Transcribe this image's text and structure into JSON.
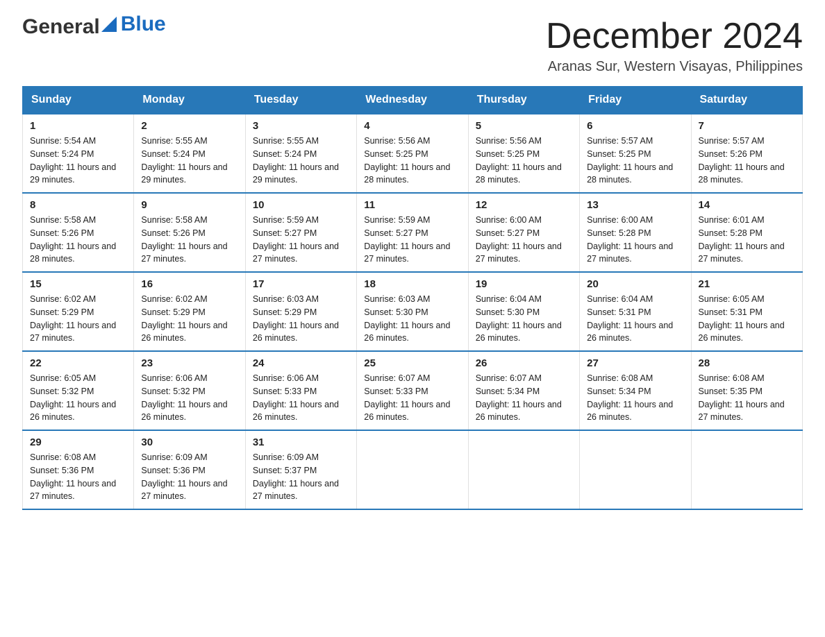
{
  "header": {
    "logo_general": "General",
    "logo_blue": "Blue",
    "month_title": "December 2024",
    "location": "Aranas Sur, Western Visayas, Philippines"
  },
  "weekdays": [
    "Sunday",
    "Monday",
    "Tuesday",
    "Wednesday",
    "Thursday",
    "Friday",
    "Saturday"
  ],
  "weeks": [
    [
      {
        "day": "1",
        "sunrise": "5:54 AM",
        "sunset": "5:24 PM",
        "daylight": "11 hours and 29 minutes."
      },
      {
        "day": "2",
        "sunrise": "5:55 AM",
        "sunset": "5:24 PM",
        "daylight": "11 hours and 29 minutes."
      },
      {
        "day": "3",
        "sunrise": "5:55 AM",
        "sunset": "5:24 PM",
        "daylight": "11 hours and 29 minutes."
      },
      {
        "day": "4",
        "sunrise": "5:56 AM",
        "sunset": "5:25 PM",
        "daylight": "11 hours and 28 minutes."
      },
      {
        "day": "5",
        "sunrise": "5:56 AM",
        "sunset": "5:25 PM",
        "daylight": "11 hours and 28 minutes."
      },
      {
        "day": "6",
        "sunrise": "5:57 AM",
        "sunset": "5:25 PM",
        "daylight": "11 hours and 28 minutes."
      },
      {
        "day": "7",
        "sunrise": "5:57 AM",
        "sunset": "5:26 PM",
        "daylight": "11 hours and 28 minutes."
      }
    ],
    [
      {
        "day": "8",
        "sunrise": "5:58 AM",
        "sunset": "5:26 PM",
        "daylight": "11 hours and 28 minutes."
      },
      {
        "day": "9",
        "sunrise": "5:58 AM",
        "sunset": "5:26 PM",
        "daylight": "11 hours and 27 minutes."
      },
      {
        "day": "10",
        "sunrise": "5:59 AM",
        "sunset": "5:27 PM",
        "daylight": "11 hours and 27 minutes."
      },
      {
        "day": "11",
        "sunrise": "5:59 AM",
        "sunset": "5:27 PM",
        "daylight": "11 hours and 27 minutes."
      },
      {
        "day": "12",
        "sunrise": "6:00 AM",
        "sunset": "5:27 PM",
        "daylight": "11 hours and 27 minutes."
      },
      {
        "day": "13",
        "sunrise": "6:00 AM",
        "sunset": "5:28 PM",
        "daylight": "11 hours and 27 minutes."
      },
      {
        "day": "14",
        "sunrise": "6:01 AM",
        "sunset": "5:28 PM",
        "daylight": "11 hours and 27 minutes."
      }
    ],
    [
      {
        "day": "15",
        "sunrise": "6:02 AM",
        "sunset": "5:29 PM",
        "daylight": "11 hours and 27 minutes."
      },
      {
        "day": "16",
        "sunrise": "6:02 AM",
        "sunset": "5:29 PM",
        "daylight": "11 hours and 26 minutes."
      },
      {
        "day": "17",
        "sunrise": "6:03 AM",
        "sunset": "5:29 PM",
        "daylight": "11 hours and 26 minutes."
      },
      {
        "day": "18",
        "sunrise": "6:03 AM",
        "sunset": "5:30 PM",
        "daylight": "11 hours and 26 minutes."
      },
      {
        "day": "19",
        "sunrise": "6:04 AM",
        "sunset": "5:30 PM",
        "daylight": "11 hours and 26 minutes."
      },
      {
        "day": "20",
        "sunrise": "6:04 AM",
        "sunset": "5:31 PM",
        "daylight": "11 hours and 26 minutes."
      },
      {
        "day": "21",
        "sunrise": "6:05 AM",
        "sunset": "5:31 PM",
        "daylight": "11 hours and 26 minutes."
      }
    ],
    [
      {
        "day": "22",
        "sunrise": "6:05 AM",
        "sunset": "5:32 PM",
        "daylight": "11 hours and 26 minutes."
      },
      {
        "day": "23",
        "sunrise": "6:06 AM",
        "sunset": "5:32 PM",
        "daylight": "11 hours and 26 minutes."
      },
      {
        "day": "24",
        "sunrise": "6:06 AM",
        "sunset": "5:33 PM",
        "daylight": "11 hours and 26 minutes."
      },
      {
        "day": "25",
        "sunrise": "6:07 AM",
        "sunset": "5:33 PM",
        "daylight": "11 hours and 26 minutes."
      },
      {
        "day": "26",
        "sunrise": "6:07 AM",
        "sunset": "5:34 PM",
        "daylight": "11 hours and 26 minutes."
      },
      {
        "day": "27",
        "sunrise": "6:08 AM",
        "sunset": "5:34 PM",
        "daylight": "11 hours and 26 minutes."
      },
      {
        "day": "28",
        "sunrise": "6:08 AM",
        "sunset": "5:35 PM",
        "daylight": "11 hours and 27 minutes."
      }
    ],
    [
      {
        "day": "29",
        "sunrise": "6:08 AM",
        "sunset": "5:36 PM",
        "daylight": "11 hours and 27 minutes."
      },
      {
        "day": "30",
        "sunrise": "6:09 AM",
        "sunset": "5:36 PM",
        "daylight": "11 hours and 27 minutes."
      },
      {
        "day": "31",
        "sunrise": "6:09 AM",
        "sunset": "5:37 PM",
        "daylight": "11 hours and 27 minutes."
      },
      null,
      null,
      null,
      null
    ]
  ]
}
